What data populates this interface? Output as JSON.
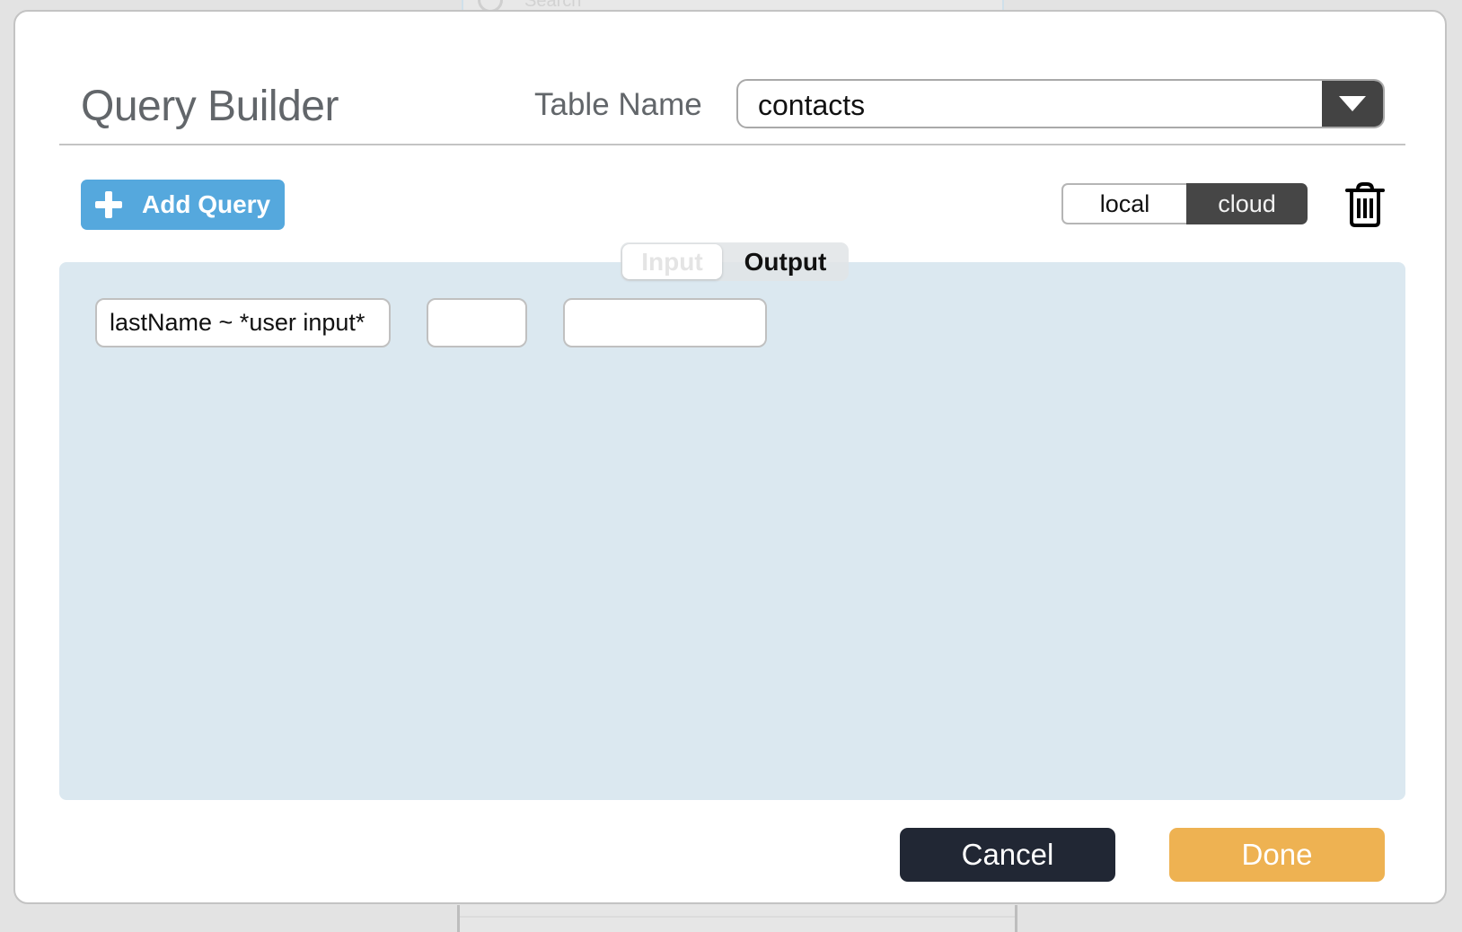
{
  "background": {
    "search_placeholder": "Search"
  },
  "modal": {
    "title": "Query Builder",
    "table_name_label": "Table Name",
    "table_select": {
      "value": "contacts",
      "dropdown_icon": "triangle-down-icon"
    },
    "add_query_label": "Add Query",
    "add_query_icon": "plus-icon",
    "location_toggle": {
      "options": [
        "local",
        "cloud"
      ],
      "selected": "cloud"
    },
    "delete_icon": "trash-icon",
    "io_toggle": {
      "options": [
        "Input",
        "Output"
      ],
      "selected": "Output"
    },
    "query_row": {
      "fields": [
        {
          "value": "lastName ~ *user input*"
        },
        {
          "value": ""
        },
        {
          "value": ""
        }
      ]
    },
    "footer": {
      "cancel_label": "Cancel",
      "done_label": "Done"
    }
  },
  "colors": {
    "primary_blue": "#55a8dd",
    "done_orange": "#eeb252",
    "cancel_dark": "#212734",
    "toggle_active": "#464646",
    "panel_bg": "#dbe8f0"
  }
}
